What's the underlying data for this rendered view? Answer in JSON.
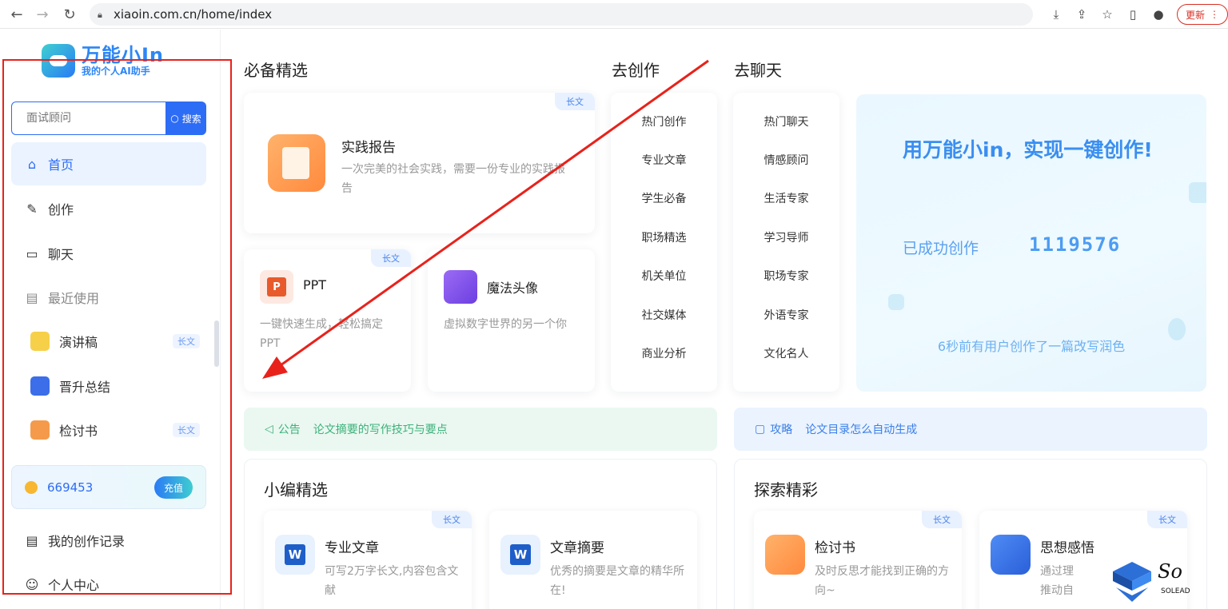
{
  "browser": {
    "url": "xiaoin.com.cn/home/index",
    "update_label": "更新"
  },
  "logo": {
    "title": "万能小In",
    "subtitle": "我的个人AI助手"
  },
  "search": {
    "placeholder": "面试顾问",
    "button_label": "搜索"
  },
  "sidebar": {
    "menu": [
      {
        "label": "首页",
        "icon": "home-icon"
      },
      {
        "label": "创作",
        "icon": "edit-icon"
      },
      {
        "label": "聊天",
        "icon": "chat-icon"
      },
      {
        "label": "最近使用",
        "icon": "recent-icon"
      }
    ],
    "recent": [
      {
        "label": "演讲稿",
        "tag": "长文"
      },
      {
        "label": "晋升总结",
        "tag": ""
      },
      {
        "label": "检讨书",
        "tag": "长文"
      }
    ],
    "coins": "669453",
    "recharge_label": "充值",
    "bottom": [
      {
        "label": "我的创作记录",
        "icon": "document-icon"
      },
      {
        "label": "个人中心",
        "icon": "smile-icon"
      }
    ]
  },
  "sections": {
    "featured": "必备精选",
    "create": "去创作",
    "chat": "去聊天",
    "editor": "小编精选",
    "explore": "探索精彩"
  },
  "featured": {
    "main": {
      "tag": "长文",
      "title": "实践报告",
      "desc": "一次完美的社会实践，需要一份专业的实践报告"
    },
    "ppt": {
      "tag": "长文",
      "badge": "P",
      "title": "PPT",
      "desc": "一键快速生成，轻松搞定PPT"
    },
    "avatar": {
      "title": "魔法头像",
      "desc": "虚拟数字世界的另一个你"
    }
  },
  "create_links": [
    "热门创作",
    "专业文章",
    "学生必备",
    "职场精选",
    "机关单位",
    "社交媒体",
    "商业分析"
  ],
  "chat_links": [
    "热门聊天",
    "情感顾问",
    "生活专家",
    "学习导师",
    "职场专家",
    "外语专家",
    "文化名人"
  ],
  "hero": {
    "title": "用万能小in，实现一键创作!",
    "label": "已成功创作",
    "count": "1119576",
    "footer": "6秒前有用户创作了一篇改写润色"
  },
  "notices": {
    "announce_label": "公告",
    "announce_text": "论文摘要的写作技巧与要点",
    "guide_label": "攻略",
    "guide_text": "论文目录怎么自动生成"
  },
  "editor_cards": [
    {
      "tag": "长文",
      "title": "专业文章",
      "desc": "可写2万字长文,内容包含文献"
    },
    {
      "tag": "",
      "title": "文章摘要",
      "desc": "优秀的摘要是文章的精华所在!"
    }
  ],
  "explore_cards": [
    {
      "tag": "长文",
      "title": "检讨书",
      "desc": "及时反思才能找到正确的方向~"
    },
    {
      "tag": "长文",
      "title": "思想感悟",
      "desc": "通过理推动自"
    }
  ],
  "watermark": {
    "text": "SOLEAD",
    "mark": "So"
  },
  "colors": {
    "accent": "#2d6cf5",
    "annotation": "#e8221b"
  }
}
